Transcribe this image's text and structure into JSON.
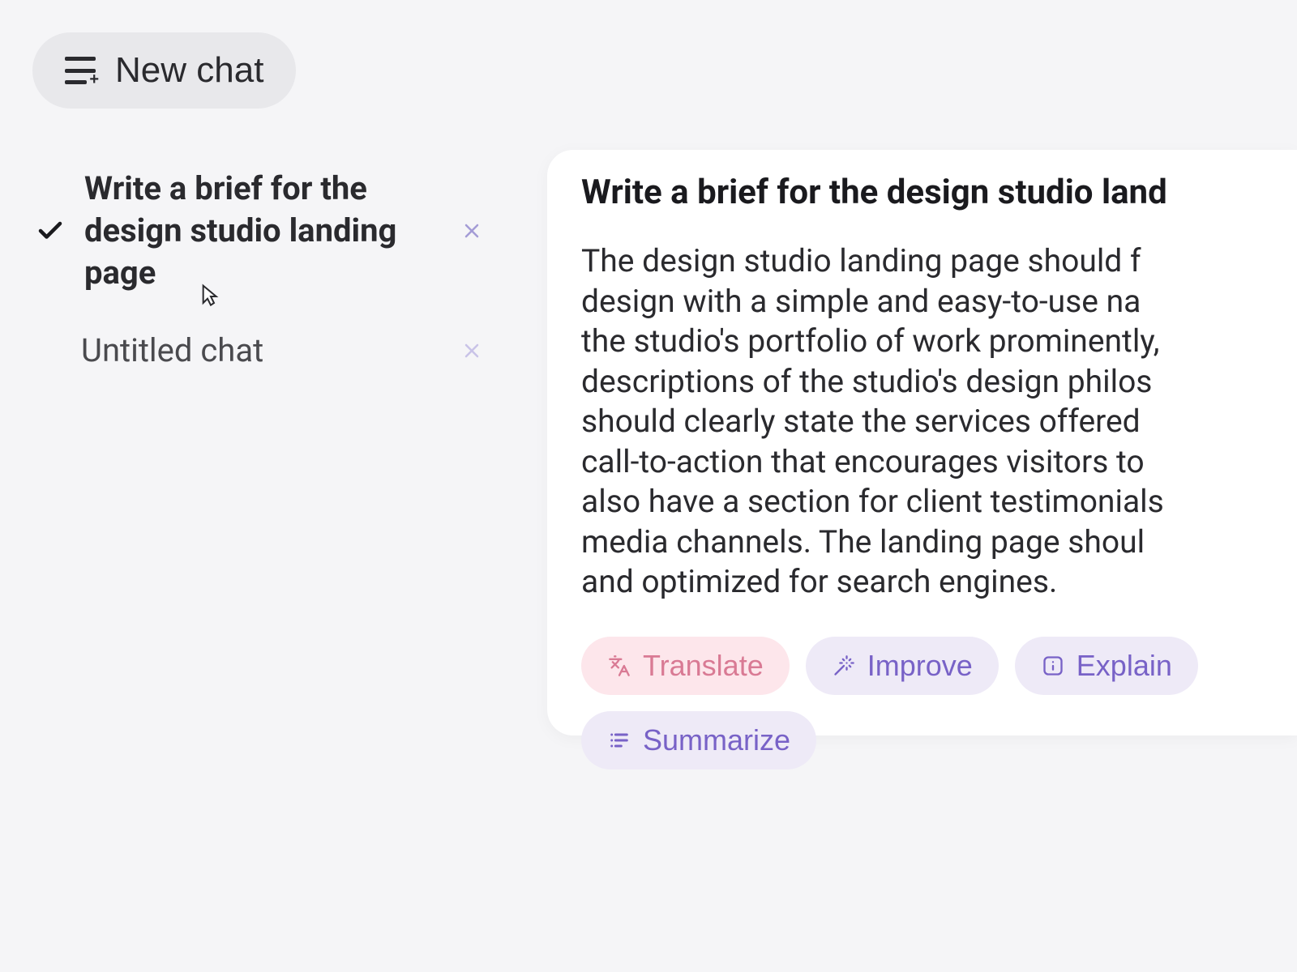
{
  "header": {
    "new_chat_label": "New chat"
  },
  "chat_list": [
    {
      "title": "Write a brief for the design studio landing page",
      "active": true
    },
    {
      "title": "Untitled chat",
      "active": false
    }
  ],
  "content": {
    "title": "Write a brief for the design studio land",
    "body_lines": [
      "The design studio landing page should f",
      "design with a simple and easy-to-use na",
      "the studio's portfolio of work prominently,",
      "descriptions of the studio's design philos",
      "should clearly state the services offered ",
      "call-to-action that encourages visitors to ",
      "also have a section for client testimonials",
      "media channels. The landing page shoul",
      "and optimized for search engines."
    ]
  },
  "actions": {
    "translate": "Translate",
    "improve": "Improve",
    "explain": "Explain",
    "summarize": "Summarize"
  }
}
